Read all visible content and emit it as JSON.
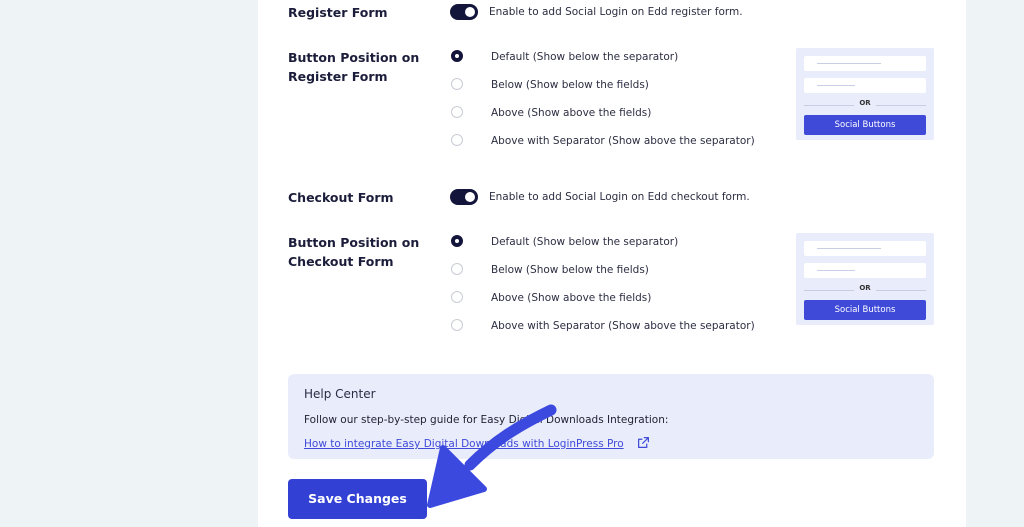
{
  "register": {
    "label": "Register Form",
    "toggle_desc": "Enable to add Social Login on Edd register form.",
    "position_label_line1": "Button Position on",
    "position_label_line2": "Register Form",
    "options": [
      "Default (Show below the separator)",
      "Below (Show below the fields)",
      "Above (Show above the fields)",
      "Above with Separator (Show above the separator)"
    ],
    "selected_index": 0,
    "preview": {
      "separator": "OR",
      "button": "Social Buttons"
    }
  },
  "checkout": {
    "label": "Checkout Form",
    "toggle_desc": "Enable to add Social Login on Edd checkout form.",
    "position_label_line1": "Button Position on",
    "position_label_line2": "Checkout Form",
    "options": [
      "Default (Show below the separator)",
      "Below (Show below the fields)",
      "Above (Show above the fields)",
      "Above with Separator (Show above the separator)"
    ],
    "selected_index": 0,
    "preview": {
      "separator": "OR",
      "button": "Social Buttons"
    }
  },
  "help": {
    "title": "Help Center",
    "text": "Follow our step-by-step guide for Easy Digital Downloads Integration:",
    "link": "How to integrate Easy Digital Downloads with LoginPress Pro"
  },
  "save_label": "Save Changes",
  "colors": {
    "accent": "#3340d4",
    "toggle_on": "#13153a",
    "help_bg": "#e9ecfb",
    "page_bg": "#eef3f6",
    "arrow": "#3b49df"
  }
}
